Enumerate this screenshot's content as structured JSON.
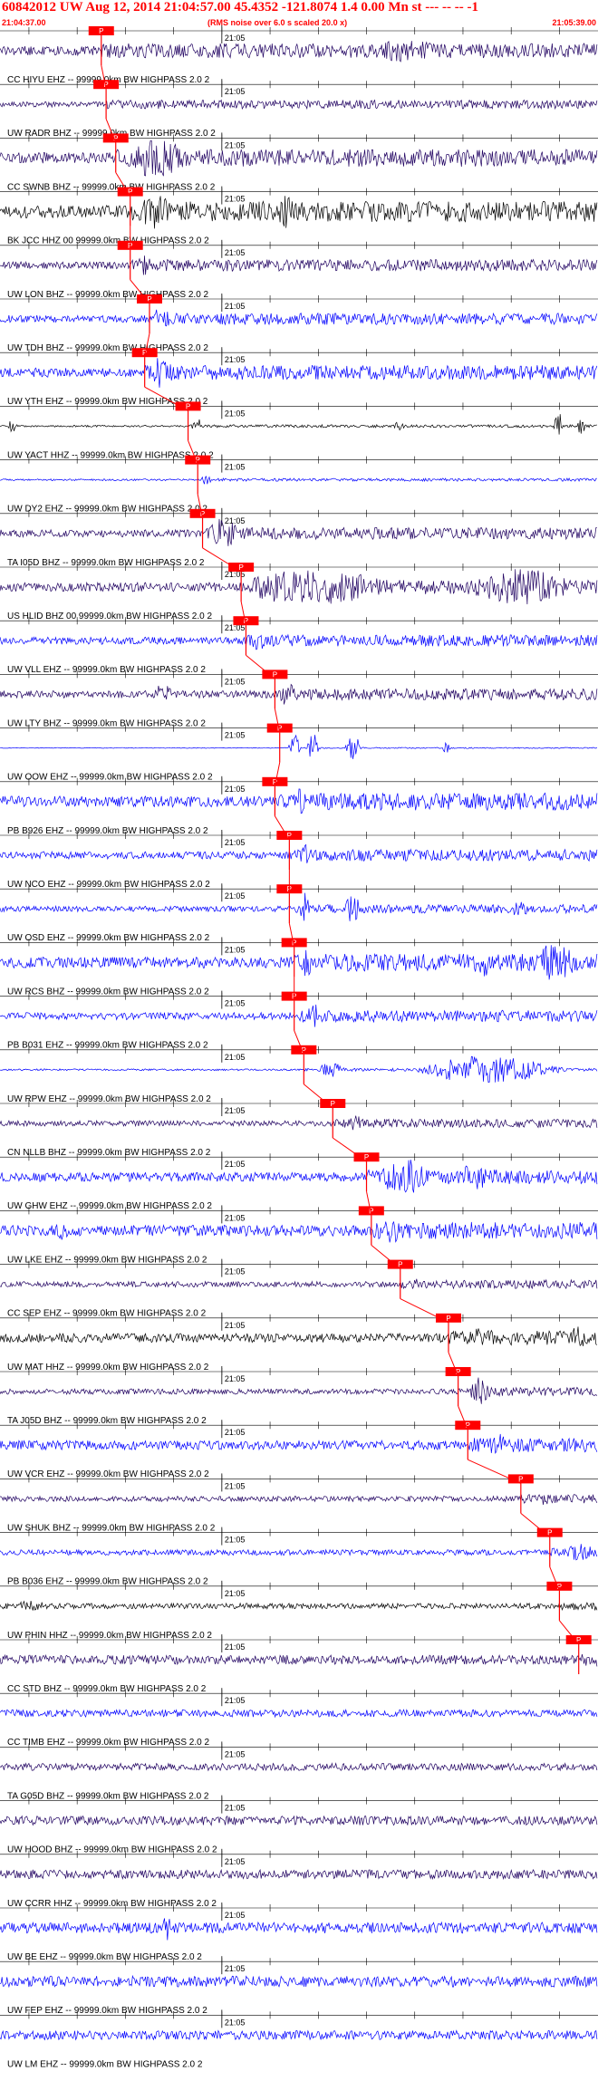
{
  "header": {
    "title": "60842012 UW Aug 12, 2014 21:04:57.00   45.4352 -121.8074  1.4 0.00 Mn st --- -- --  -1",
    "start_time": "21:04:37.00",
    "note": "(RMS noise over 6.0 s scaled 20.0 x)",
    "end_time": "21:05:39.00"
  },
  "colors": {
    "blue": "#0000ff",
    "purple": "#1f0060",
    "black": "#000000",
    "pick_box": "#ff0000",
    "grid": "#000000"
  },
  "chart_data": {
    "type": "line",
    "title": "60842012 UW Aug 12, 2014 21:04:57.00   45.4352 -121.8074  1.4 0.00 Mn st --- -- --  -1",
    "x_axis": {
      "start": "21:04:37.00",
      "end": "21:05:39.00",
      "minute_mark": "21:05"
    },
    "pick_label": "P",
    "traces": [
      {
        "label": "CC HIYU EHZ -- 99999.0km BW HIGHPASS  2.0  2",
        "color": "purple",
        "pick_s": 10.5,
        "amp": 0.25,
        "bursts": [
          [
            40,
            0.55,
            4
          ],
          [
            43,
            0.4,
            3
          ]
        ]
      },
      {
        "label": "UW RADR BHZ -- 99999.0km BW HIGHPASS  2.0  2",
        "color": "purple",
        "pick_s": 11.0,
        "amp": 0.15,
        "bursts": []
      },
      {
        "label": "CC SWNB BHZ -- 99999.0km BW HIGHPASS  2.0  2",
        "color": "purple",
        "pick_s": 12.0,
        "amp": 0.3,
        "bursts": [
          [
            14,
            1.0,
            6
          ]
        ]
      },
      {
        "label": "BK JCC HHZ 00 99999.0km BW HIGHPASS  2.0  2",
        "color": "black",
        "pick_s": 13.5,
        "amp": 0.35,
        "bursts": [
          [
            15,
            0.8,
            3
          ],
          [
            29,
            0.7,
            2
          ]
        ]
      },
      {
        "label": "UW LON BHZ -- 99999.0km BW HIGHPASS  2.0  2",
        "color": "purple",
        "pick_s": 13.5,
        "amp": 0.2,
        "bursts": [
          [
            14,
            0.45,
            2
          ]
        ]
      },
      {
        "label": "UW TDH BHZ -- 99999.0km BW HIGHPASS  2.0  2",
        "color": "blue",
        "pick_s": 15.5,
        "amp": 0.2,
        "bursts": [
          [
            16,
            0.6,
            2
          ]
        ]
      },
      {
        "label": "UW YTH EHZ -- 99999.0km BW HIGHPASS  2.0  2",
        "color": "blue",
        "pick_s": 15.0,
        "amp": 0.25,
        "bursts": [
          [
            16,
            1.0,
            2
          ]
        ]
      },
      {
        "label": "UW YACT HHZ -- 99999.0km BW HIGHPASS  2.0  2",
        "color": "black",
        "pick_s": 19.5,
        "amp": 0.05,
        "bursts": [
          [
            1,
            0.55,
            0.8
          ],
          [
            20,
            0.6,
            1
          ],
          [
            41,
            0.3,
            1
          ],
          [
            57.5,
            0.9,
            1
          ],
          [
            60,
            0.7,
            0.8
          ]
        ]
      },
      {
        "label": "UW DY2 EHZ -- 99999.0km BW HIGHPASS  2.0  2",
        "color": "blue",
        "pick_s": 20.5,
        "amp": 0.05,
        "bursts": [
          [
            21,
            0.3,
            1
          ]
        ]
      },
      {
        "label": "TA I05D BHZ -- 99999.0km BW HIGHPASS  2.0  2",
        "color": "purple",
        "pick_s": 21.0,
        "amp": 0.2,
        "bursts": [
          [
            22,
            0.8,
            3
          ]
        ]
      },
      {
        "label": "US HLID BHZ 00 99999.0km BW HIGHPASS  2.0  2",
        "color": "purple",
        "pick_s": 25.0,
        "amp": 0.25,
        "bursts": [
          [
            27,
            1.0,
            14
          ],
          [
            50,
            1.0,
            10
          ]
        ]
      },
      {
        "label": "UW VLL EHZ -- 99999.0km BW HIGHPASS  2.0  2",
        "color": "blue",
        "pick_s": 25.5,
        "amp": 0.2,
        "bursts": [
          [
            26,
            0.4,
            2
          ]
        ]
      },
      {
        "label": "UW LTY BHZ -- 99999.0km BW HIGHPASS  2.0  2",
        "color": "purple",
        "pick_s": 28.5,
        "amp": 0.2,
        "bursts": [
          [
            16,
            0.5,
            2
          ],
          [
            29,
            0.6,
            2
          ]
        ]
      },
      {
        "label": "UW OOW EHZ -- 99999.0km BW HIGHPASS  2.0  2",
        "color": "blue",
        "pick_s": 29.0,
        "amp": 0.02,
        "bursts": [
          [
            30,
            1.0,
            1.2
          ],
          [
            32,
            1.0,
            1.2
          ],
          [
            36,
            1.0,
            1.5
          ],
          [
            46,
            0.5,
            0.8
          ]
        ]
      },
      {
        "label": "PB B926 EHZ -- 99999.0km BW HIGHPASS  2.0  2",
        "color": "blue",
        "pick_s": 28.5,
        "amp": 0.3,
        "bursts": [
          [
            30,
            0.6,
            2
          ]
        ]
      },
      {
        "label": "UW NCO EHZ -- 99999.0km BW HIGHPASS  2.0  2",
        "color": "blue",
        "pick_s": 30.0,
        "amp": 0.2,
        "bursts": [
          [
            31,
            0.5,
            2
          ]
        ]
      },
      {
        "label": "UW OSD EHZ -- 99999.0km BW HIGHPASS  2.0  2",
        "color": "blue",
        "pick_s": 30.0,
        "amp": 0.15,
        "bursts": [
          [
            31,
            1.0,
            1.2
          ],
          [
            36,
            1.0,
            1.5
          ],
          [
            53,
            0.4,
            2
          ]
        ]
      },
      {
        "label": "UW RCS BHZ -- 99999.0km BW HIGHPASS  2.0  2",
        "color": "blue",
        "pick_s": 30.5,
        "amp": 0.3,
        "bursts": [
          [
            31,
            0.6,
            2
          ],
          [
            49,
            0.6,
            3
          ],
          [
            56,
            1.0,
            4
          ]
        ]
      },
      {
        "label": "PB B031 EHZ -- 99999.0km BW HIGHPASS  2.0  2",
        "color": "blue",
        "pick_s": 30.5,
        "amp": 0.2,
        "bursts": [
          [
            32,
            0.8,
            1.5
          ]
        ]
      },
      {
        "label": "UW RPW EHZ -- 99999.0km BW HIGHPASS  2.0  2",
        "color": "blue",
        "pick_s": 31.5,
        "amp": 0.05,
        "bursts": [
          [
            33,
            0.5,
            3
          ],
          [
            45,
            0.9,
            14
          ]
        ]
      },
      {
        "label": "CN NLLB BHZ -- 99999.0km BW HIGHPASS  2.0  2",
        "color": "purple",
        "pick_s": 34.5,
        "amp": 0.15,
        "bursts": [
          [
            36,
            0.35,
            2
          ]
        ]
      },
      {
        "label": "UW GHW EHZ -- 99999.0km BW HIGHPASS  2.0  2",
        "color": "blue",
        "pick_s": 38.0,
        "amp": 0.25,
        "bursts": [
          [
            40,
            1.0,
            5
          ],
          [
            48,
            0.7,
            4
          ]
        ]
      },
      {
        "label": "UW LKE EHZ -- 99999.0km BW HIGHPASS  2.0  2",
        "color": "blue",
        "pick_s": 38.5,
        "amp": 0.3,
        "bursts": [
          [
            6,
            0.5,
            1
          ],
          [
            40,
            0.6,
            3
          ]
        ]
      },
      {
        "label": "CC SEP EHZ -- 99999.0km BW HIGHPASS  2.0  2",
        "color": "purple",
        "pick_s": 41.5,
        "amp": 0.15,
        "bursts": [
          [
            43,
            0.3,
            2
          ]
        ]
      },
      {
        "label": "UW MAT HHZ -- 99999.0km BW HIGHPASS  2.0  2",
        "color": "black",
        "pick_s": 46.5,
        "amp": 0.25,
        "bursts": [
          [
            49,
            0.5,
            3
          ],
          [
            59,
            0.5,
            2
          ]
        ]
      },
      {
        "label": "TA J05D BHZ -- 99999.0km BW HIGHPASS  2.0  2",
        "color": "purple",
        "pick_s": 47.5,
        "amp": 0.15,
        "bursts": [
          [
            49,
            0.8,
            2
          ]
        ]
      },
      {
        "label": "UW VCR EHZ -- 99999.0km BW HIGHPASS  2.0  2",
        "color": "blue",
        "pick_s": 48.5,
        "amp": 0.25,
        "bursts": [
          [
            51,
            0.7,
            1.5
          ]
        ]
      },
      {
        "label": "UW SHUK BHZ -- 99999.0km BW HIGHPASS  2.0  2",
        "color": "purple",
        "pick_s": 54.0,
        "amp": 0.15,
        "bursts": [
          [
            56,
            0.3,
            1.5
          ]
        ]
      },
      {
        "label": "PB B036 EHZ -- 99999.0km BW HIGHPASS  2.0  2",
        "color": "blue",
        "pick_s": 57.0,
        "amp": 0.15,
        "bursts": [
          [
            59,
            0.4,
            3
          ]
        ]
      },
      {
        "label": "UW PHIN HHZ -- 99999.0km BW HIGHPASS  2.0  2",
        "color": "black",
        "pick_s": 58.0,
        "amp": 0.15,
        "bursts": [
          [
            2,
            0.2,
            3
          ]
        ]
      },
      {
        "label": "CC STD BHZ -- 99999.0km BW HIGHPASS  2.0  2",
        "color": "purple",
        "pick_s": 60.0,
        "amp": 0.25,
        "bursts": [
          [
            62,
            0.5,
            1
          ]
        ]
      },
      {
        "label": "CC TIMB EHZ -- 99999.0km BW HIGHPASS  2.0  2",
        "color": "blue",
        "pick_s": null,
        "amp": 0.2,
        "bursts": []
      },
      {
        "label": "TA G05D BHZ -- 99999.0km BW HIGHPASS  2.0  2",
        "color": "purple",
        "pick_s": null,
        "amp": 0.2,
        "bursts": []
      },
      {
        "label": "UW HOOD BHZ -- 99999.0km BW HIGHPASS  2.0  2",
        "color": "purple",
        "pick_s": null,
        "amp": 0.25,
        "bursts": []
      },
      {
        "label": "UW CCRR HHZ -- 99999.0km BW HIGHPASS  2.0  2",
        "color": "purple",
        "pick_s": null,
        "amp": 0.25,
        "bursts": []
      },
      {
        "label": "UW BE EHZ -- 99999.0km BW HIGHPASS  2.0  2",
        "color": "blue",
        "pick_s": null,
        "amp": 0.3,
        "bursts": [
          [
            17,
            0.6,
            1
          ]
        ]
      },
      {
        "label": "UW FEP EHZ -- 99999.0km BW HIGHPASS  2.0  2",
        "color": "blue",
        "pick_s": null,
        "amp": 0.3,
        "bursts": []
      },
      {
        "label": "UW LM EHZ -- 99999.0km BW HIGHPASS  2.0  2",
        "color": "blue",
        "pick_s": null,
        "amp": 0.25,
        "bursts": []
      }
    ]
  }
}
